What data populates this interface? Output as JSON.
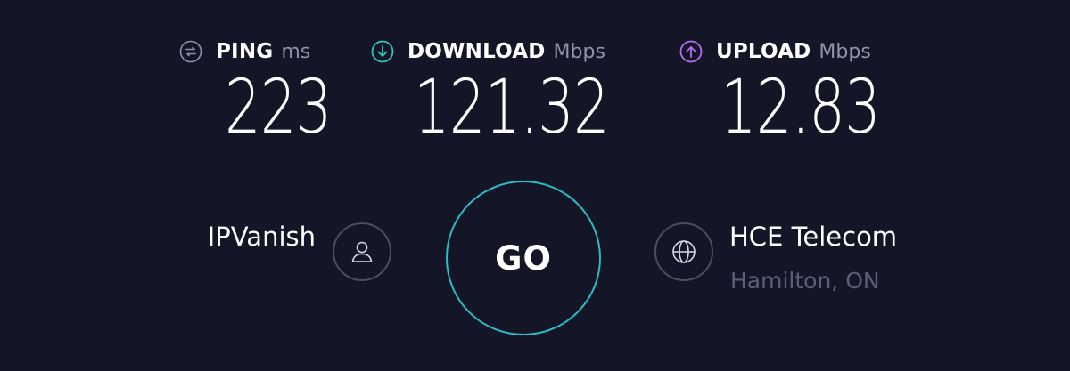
{
  "metrics": {
    "ping": {
      "label": "PING",
      "unit": "ms",
      "value": "223",
      "icon": "ping-icon",
      "color": "#9193a8"
    },
    "download": {
      "label": "DOWNLOAD",
      "unit": "Mbps",
      "value": "121.32",
      "icon": "download-arrow-icon",
      "color": "#2bc7b8"
    },
    "upload": {
      "label": "UPLOAD",
      "unit": "Mbps",
      "value": "12.83",
      "icon": "upload-arrow-icon",
      "color": "#b46cf0"
    }
  },
  "go_button": {
    "label": "GO",
    "ring_color": "#2bbcc8"
  },
  "provider": {
    "name": "IPVanish",
    "icon": "user-icon"
  },
  "server": {
    "name": "HCE Telecom",
    "location": "Hamilton, ON",
    "icon": "globe-icon"
  },
  "colors": {
    "background": "#141526",
    "muted_text": "#9193a8",
    "dim_text": "#5c5e72"
  }
}
